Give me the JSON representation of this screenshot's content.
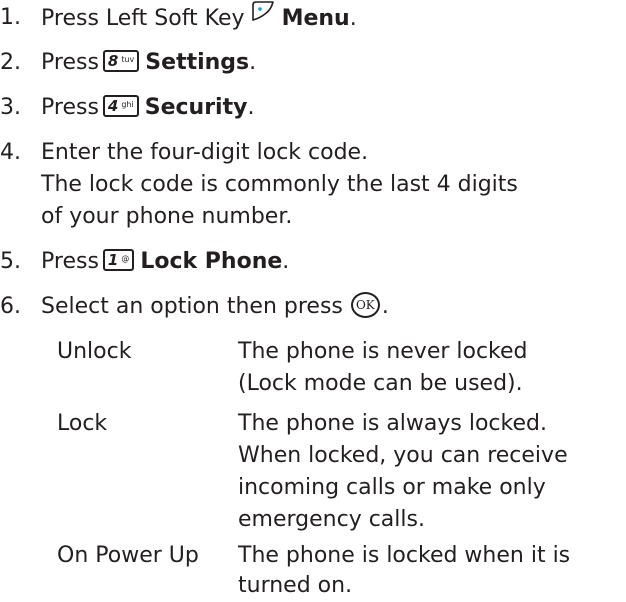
{
  "steps": [
    {
      "number": "1.",
      "prefix": "Press Left Soft Key",
      "key_icon": "left-soft-key-icon",
      "label": "Menu",
      "suffix": "."
    },
    {
      "number": "2.",
      "prefix": "Press",
      "key_digit": "8",
      "key_letters": "tuv",
      "label": "Settings",
      "suffix": "."
    },
    {
      "number": "3.",
      "prefix": "Press",
      "key_digit": "4",
      "key_letters": "ghi",
      "label": "Security",
      "suffix": "."
    },
    {
      "number": "4.",
      "line1": "Enter the four-digit lock code.",
      "line2": "The lock code is commonly the last 4 digits",
      "line3": "of your phone number."
    },
    {
      "number": "5.",
      "prefix": "Press",
      "key_digit": "1",
      "key_letters": "@",
      "label": "Lock Phone",
      "suffix": "."
    },
    {
      "number": "6.",
      "prefix": "Select an option then press",
      "key_text": "OK",
      "suffix": "."
    }
  ],
  "options": [
    {
      "name": "Unlock",
      "desc_lines": [
        "The phone is never locked",
        "(Lock mode can be used)."
      ]
    },
    {
      "name": "Lock",
      "desc_lines": [
        "The phone is always locked.",
        "When locked, you can receive",
        "incoming calls or make only",
        "emergency calls."
      ]
    },
    {
      "name": "On Power Up",
      "desc_lines": [
        "The phone is locked when it is",
        "turned on."
      ]
    }
  ]
}
